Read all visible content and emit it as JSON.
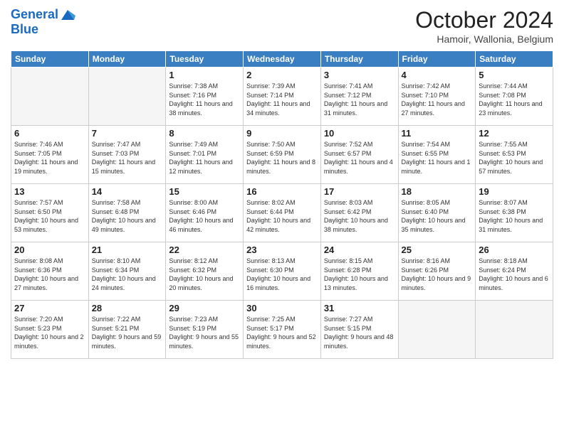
{
  "header": {
    "logo_line1": "General",
    "logo_line2": "Blue",
    "month_title": "October 2024",
    "location": "Hamoir, Wallonia, Belgium"
  },
  "weekdays": [
    "Sunday",
    "Monday",
    "Tuesday",
    "Wednesday",
    "Thursday",
    "Friday",
    "Saturday"
  ],
  "weeks": [
    [
      {
        "day": "",
        "info": ""
      },
      {
        "day": "",
        "info": ""
      },
      {
        "day": "1",
        "info": "Sunrise: 7:38 AM\nSunset: 7:16 PM\nDaylight: 11 hours and 38 minutes."
      },
      {
        "day": "2",
        "info": "Sunrise: 7:39 AM\nSunset: 7:14 PM\nDaylight: 11 hours and 34 minutes."
      },
      {
        "day": "3",
        "info": "Sunrise: 7:41 AM\nSunset: 7:12 PM\nDaylight: 11 hours and 31 minutes."
      },
      {
        "day": "4",
        "info": "Sunrise: 7:42 AM\nSunset: 7:10 PM\nDaylight: 11 hours and 27 minutes."
      },
      {
        "day": "5",
        "info": "Sunrise: 7:44 AM\nSunset: 7:08 PM\nDaylight: 11 hours and 23 minutes."
      }
    ],
    [
      {
        "day": "6",
        "info": "Sunrise: 7:46 AM\nSunset: 7:05 PM\nDaylight: 11 hours and 19 minutes."
      },
      {
        "day": "7",
        "info": "Sunrise: 7:47 AM\nSunset: 7:03 PM\nDaylight: 11 hours and 15 minutes."
      },
      {
        "day": "8",
        "info": "Sunrise: 7:49 AM\nSunset: 7:01 PM\nDaylight: 11 hours and 12 minutes."
      },
      {
        "day": "9",
        "info": "Sunrise: 7:50 AM\nSunset: 6:59 PM\nDaylight: 11 hours and 8 minutes."
      },
      {
        "day": "10",
        "info": "Sunrise: 7:52 AM\nSunset: 6:57 PM\nDaylight: 11 hours and 4 minutes."
      },
      {
        "day": "11",
        "info": "Sunrise: 7:54 AM\nSunset: 6:55 PM\nDaylight: 11 hours and 1 minute."
      },
      {
        "day": "12",
        "info": "Sunrise: 7:55 AM\nSunset: 6:53 PM\nDaylight: 10 hours and 57 minutes."
      }
    ],
    [
      {
        "day": "13",
        "info": "Sunrise: 7:57 AM\nSunset: 6:50 PM\nDaylight: 10 hours and 53 minutes."
      },
      {
        "day": "14",
        "info": "Sunrise: 7:58 AM\nSunset: 6:48 PM\nDaylight: 10 hours and 49 minutes."
      },
      {
        "day": "15",
        "info": "Sunrise: 8:00 AM\nSunset: 6:46 PM\nDaylight: 10 hours and 46 minutes."
      },
      {
        "day": "16",
        "info": "Sunrise: 8:02 AM\nSunset: 6:44 PM\nDaylight: 10 hours and 42 minutes."
      },
      {
        "day": "17",
        "info": "Sunrise: 8:03 AM\nSunset: 6:42 PM\nDaylight: 10 hours and 38 minutes."
      },
      {
        "day": "18",
        "info": "Sunrise: 8:05 AM\nSunset: 6:40 PM\nDaylight: 10 hours and 35 minutes."
      },
      {
        "day": "19",
        "info": "Sunrise: 8:07 AM\nSunset: 6:38 PM\nDaylight: 10 hours and 31 minutes."
      }
    ],
    [
      {
        "day": "20",
        "info": "Sunrise: 8:08 AM\nSunset: 6:36 PM\nDaylight: 10 hours and 27 minutes."
      },
      {
        "day": "21",
        "info": "Sunrise: 8:10 AM\nSunset: 6:34 PM\nDaylight: 10 hours and 24 minutes."
      },
      {
        "day": "22",
        "info": "Sunrise: 8:12 AM\nSunset: 6:32 PM\nDaylight: 10 hours and 20 minutes."
      },
      {
        "day": "23",
        "info": "Sunrise: 8:13 AM\nSunset: 6:30 PM\nDaylight: 10 hours and 16 minutes."
      },
      {
        "day": "24",
        "info": "Sunrise: 8:15 AM\nSunset: 6:28 PM\nDaylight: 10 hours and 13 minutes."
      },
      {
        "day": "25",
        "info": "Sunrise: 8:16 AM\nSunset: 6:26 PM\nDaylight: 10 hours and 9 minutes."
      },
      {
        "day": "26",
        "info": "Sunrise: 8:18 AM\nSunset: 6:24 PM\nDaylight: 10 hours and 6 minutes."
      }
    ],
    [
      {
        "day": "27",
        "info": "Sunrise: 7:20 AM\nSunset: 5:23 PM\nDaylight: 10 hours and 2 minutes."
      },
      {
        "day": "28",
        "info": "Sunrise: 7:22 AM\nSunset: 5:21 PM\nDaylight: 9 hours and 59 minutes."
      },
      {
        "day": "29",
        "info": "Sunrise: 7:23 AM\nSunset: 5:19 PM\nDaylight: 9 hours and 55 minutes."
      },
      {
        "day": "30",
        "info": "Sunrise: 7:25 AM\nSunset: 5:17 PM\nDaylight: 9 hours and 52 minutes."
      },
      {
        "day": "31",
        "info": "Sunrise: 7:27 AM\nSunset: 5:15 PM\nDaylight: 9 hours and 48 minutes."
      },
      {
        "day": "",
        "info": ""
      },
      {
        "day": "",
        "info": ""
      }
    ]
  ]
}
